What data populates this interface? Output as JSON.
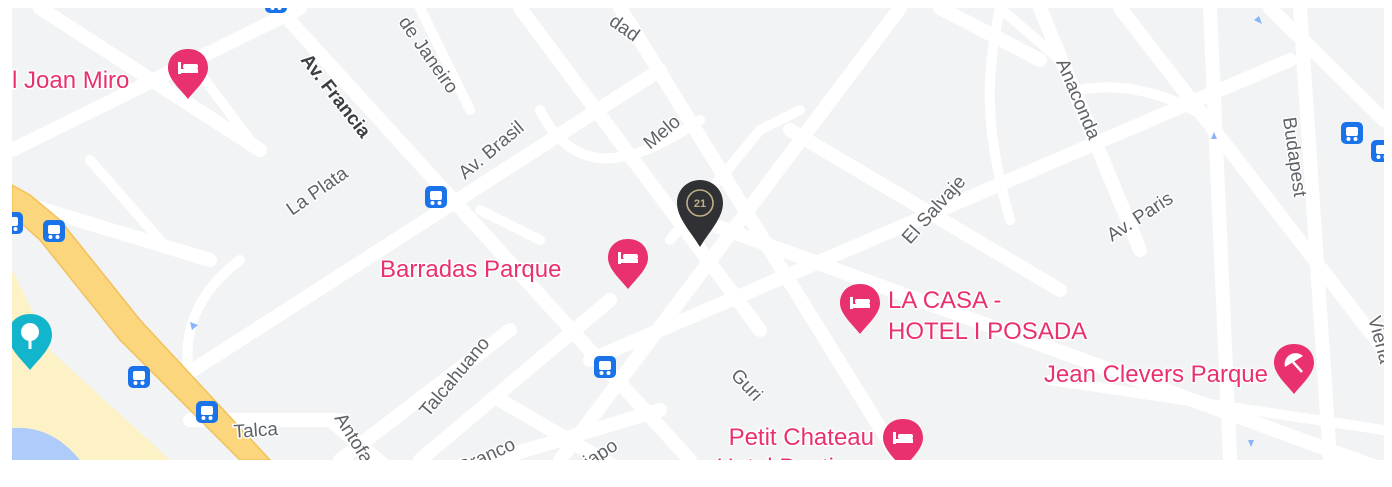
{
  "map": {
    "streets": [
      {
        "id": "av-francia",
        "name": "Av. Francia",
        "major": true
      },
      {
        "id": "av-brasil",
        "name": "Av. Brasil"
      },
      {
        "id": "la-plata",
        "name": "La Plata"
      },
      {
        "id": "rio-de-janeiro",
        "name": "de Janeiro"
      },
      {
        "id": "melo",
        "name": "Melo"
      },
      {
        "id": "libertad",
        "name": "dad"
      },
      {
        "id": "anaconda",
        "name": "Anaconda"
      },
      {
        "id": "el-salvaje",
        "name": "El Salvaje"
      },
      {
        "id": "av-paris",
        "name": "Av. Paris"
      },
      {
        "id": "budapest",
        "name": "Budapest"
      },
      {
        "id": "talcahuano",
        "name": "Talcahuano"
      },
      {
        "id": "talca",
        "name": "Talca"
      },
      {
        "id": "antofagasta",
        "name": "Antofag"
      },
      {
        "id": "rio-branco",
        "name": "Branco"
      },
      {
        "id": "copiapo",
        "name": "piapo"
      },
      {
        "id": "guri",
        "name": "Guri"
      },
      {
        "id": "viena",
        "name": "Viena"
      }
    ],
    "places": [
      {
        "id": "joan-miro",
        "name": "l Joan Miro",
        "icon": "hotel-bed-icon"
      },
      {
        "id": "barradas-parque",
        "name": "Barradas Parque",
        "icon": "hotel-bed-icon"
      },
      {
        "id": "la-casa",
        "name": "LA CASA -\nHOTEL I POSADA",
        "icon": "hotel-bed-icon"
      },
      {
        "id": "jean-clevers",
        "name": "Jean Clevers Parque",
        "icon": "beach-umbrella-icon"
      },
      {
        "id": "petit-chateau",
        "name": "Petit Chateau\nHotel Boutique",
        "icon": "hotel-bed-icon"
      }
    ],
    "transit_stop_icon": "bus-stop-icon",
    "transit_stop_count": 10,
    "park_icon": "tree-park-icon",
    "selected_marker": {
      "icon": "map-pin-icon",
      "badge_text": "21"
    },
    "colors": {
      "land": "#f1f3f4",
      "road": "#ffffff",
      "highway": "#fbd67c",
      "beach": "#fdf2c5",
      "water": "#aecbfa",
      "hotel_pink": "#e8316e",
      "transit_blue": "#1a73e8",
      "park_teal": "#12b5cb",
      "marker_dark": "#303134",
      "marker_gold": "#beaf87"
    }
  }
}
